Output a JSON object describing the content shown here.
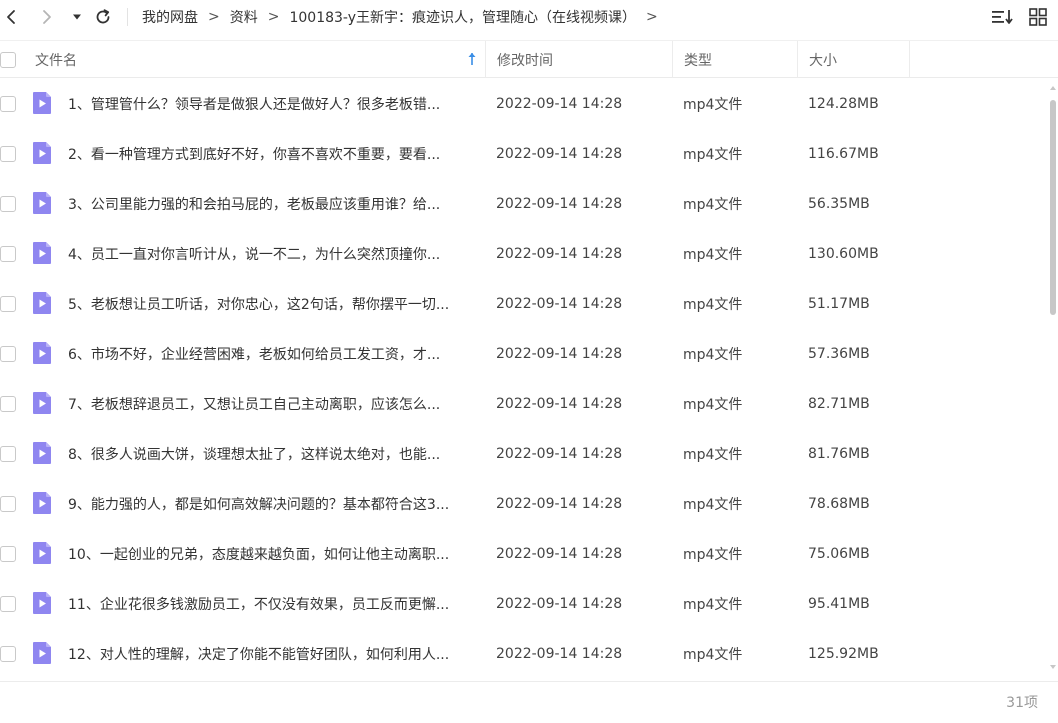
{
  "toolbar": {
    "back_icon": "chevron-left-icon",
    "forward_icon": "chevron-right-icon",
    "dropdown_icon": "caret-down-icon",
    "refresh_icon": "refresh-icon",
    "sort_icon": "sort-list-icon",
    "grid_icon": "grid-view-icon"
  },
  "breadcrumb": {
    "items": [
      "我的网盘",
      "资料",
      "100183-y王新宇：痕迹识人，管理随心（在线视频课）"
    ],
    "separator": ">"
  },
  "table": {
    "columns": {
      "name": "文件名",
      "mtime": "修改时间",
      "type": "类型",
      "size": "大小"
    },
    "sort_column": "name",
    "sort_direction": "ascending",
    "rows": [
      {
        "name": "1、管理管什么？领导者是做狠人还是做好人？很多老板错...",
        "mtime": "2022-09-14 14:28",
        "type": "mp4文件",
        "size": "124.28MB"
      },
      {
        "name": "2、看一种管理方式到底好不好，你喜不喜欢不重要，要看...",
        "mtime": "2022-09-14 14:28",
        "type": "mp4文件",
        "size": "116.67MB"
      },
      {
        "name": "3、公司里能力强的和会拍马屁的，老板最应该重用谁？给...",
        "mtime": "2022-09-14 14:28",
        "type": "mp4文件",
        "size": "56.35MB"
      },
      {
        "name": "4、员工一直对你言听计从，说一不二，为什么突然顶撞你...",
        "mtime": "2022-09-14 14:28",
        "type": "mp4文件",
        "size": "130.60MB"
      },
      {
        "name": "5、老板想让员工听话，对你忠心，这2句话，帮你摆平一切...",
        "mtime": "2022-09-14 14:28",
        "type": "mp4文件",
        "size": "51.17MB"
      },
      {
        "name": "6、市场不好，企业经营困难，老板如何给员工发工资，才...",
        "mtime": "2022-09-14 14:28",
        "type": "mp4文件",
        "size": "57.36MB"
      },
      {
        "name": "7、老板想辞退员工，又想让员工自己主动离职，应该怎么...",
        "mtime": "2022-09-14 14:28",
        "type": "mp4文件",
        "size": "82.71MB"
      },
      {
        "name": "8、很多人说画大饼，谈理想太扯了，这样说太绝对，也能...",
        "mtime": "2022-09-14 14:28",
        "type": "mp4文件",
        "size": "81.76MB"
      },
      {
        "name": "9、能力强的人，都是如何高效解决问题的？基本都符合这3...",
        "mtime": "2022-09-14 14:28",
        "type": "mp4文件",
        "size": "78.68MB"
      },
      {
        "name": "10、一起创业的兄弟，态度越来越负面，如何让他主动离职...",
        "mtime": "2022-09-14 14:28",
        "type": "mp4文件",
        "size": "75.06MB"
      },
      {
        "name": "11、企业花很多钱激励员工，不仅没有效果，员工反而更懈...",
        "mtime": "2022-09-14 14:28",
        "type": "mp4文件",
        "size": "95.41MB"
      },
      {
        "name": "12、对人性的理解，决定了你能不能管好团队，如何利用人...",
        "mtime": "2022-09-14 14:28",
        "type": "mp4文件",
        "size": "125.92MB"
      }
    ]
  },
  "file_icon": "video-file-icon",
  "colors": {
    "video_icon": "#8f86f0",
    "video_icon_fold": "#b8b2f7",
    "sort_arrow": "#3a8ee6",
    "scroll_thumb": "#c7c7c7"
  },
  "footer": {
    "item_count": "31项"
  }
}
